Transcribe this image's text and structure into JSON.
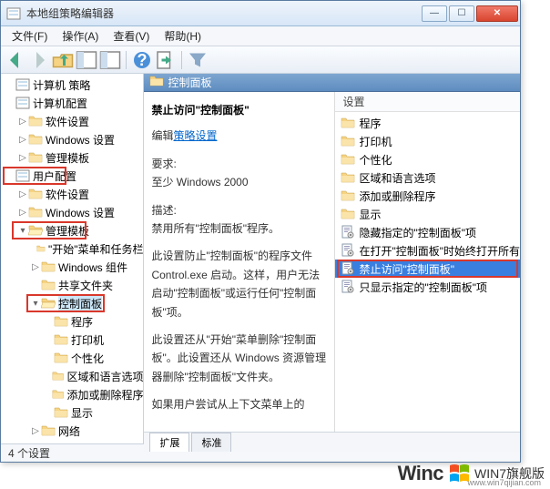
{
  "window": {
    "title": "本地组策略编辑器"
  },
  "menu": {
    "file": "文件(F)",
    "action": "操作(A)",
    "view": "查看(V)",
    "help": "帮助(H)"
  },
  "tree": {
    "root": "计算机 策略",
    "compConfig": "计算机配置",
    "compSoft": "软件设置",
    "compWin": "Windows 设置",
    "compAdmin": "管理模板",
    "userConfig": "用户配置",
    "userSoft": "软件设置",
    "userWin": "Windows 设置",
    "userAdmin": "管理模板",
    "startMenu": "\"开始\"菜单和任务栏",
    "winComp": "Windows 组件",
    "shared": "共享文件夹",
    "ctrlPanel": "控制面板",
    "programs": "程序",
    "printers": "打印机",
    "personalize": "个性化",
    "regional": "区域和语言选项",
    "addRemove": "添加或删除程序",
    "display": "显示",
    "network": "网络"
  },
  "header": {
    "title": "控制面板"
  },
  "desc": {
    "title": "禁止访问\"控制面板\"",
    "editPrefix": "编辑",
    "editLink": "策略设置",
    "reqLabel": "要求:",
    "reqValue": "至少 Windows 2000",
    "descLabel": "描述:",
    "p1": "禁用所有\"控制面板\"程序。",
    "p2": "此设置防止\"控制面板\"的程序文件 Control.exe 启动。这样，用户无法启动\"控制面板\"或运行任何\"控制面板\"项。",
    "p3": "此设置还从\"开始\"菜单删除\"控制面板\"。此设置还从 Windows 资源管理器删除\"控制面板\"文件夹。",
    "p4": "如果用户尝试从上下文菜单上的"
  },
  "settings": {
    "col": "设置",
    "items": [
      {
        "type": "folder",
        "label": "程序"
      },
      {
        "type": "folder",
        "label": "打印机"
      },
      {
        "type": "folder",
        "label": "个性化"
      },
      {
        "type": "folder",
        "label": "区域和语言选项"
      },
      {
        "type": "folder",
        "label": "添加或删除程序"
      },
      {
        "type": "folder",
        "label": "显示"
      },
      {
        "type": "policy",
        "label": "隐藏指定的\"控制面板\"项"
      },
      {
        "type": "policy",
        "label": "在打开\"控制面板\"时始终打开所有"
      },
      {
        "type": "policy",
        "label": "禁止访问\"控制面板\"",
        "selected": true,
        "boxed": true
      },
      {
        "type": "policy",
        "label": "只显示指定的\"控制面板\"项"
      }
    ]
  },
  "tabs": {
    "ext": "扩展",
    "std": "标准"
  },
  "status": "4 个设置",
  "watermark": {
    "big": "Winc",
    "txt": "WIN7旗舰版",
    "url": "www.win7qijian.com"
  }
}
